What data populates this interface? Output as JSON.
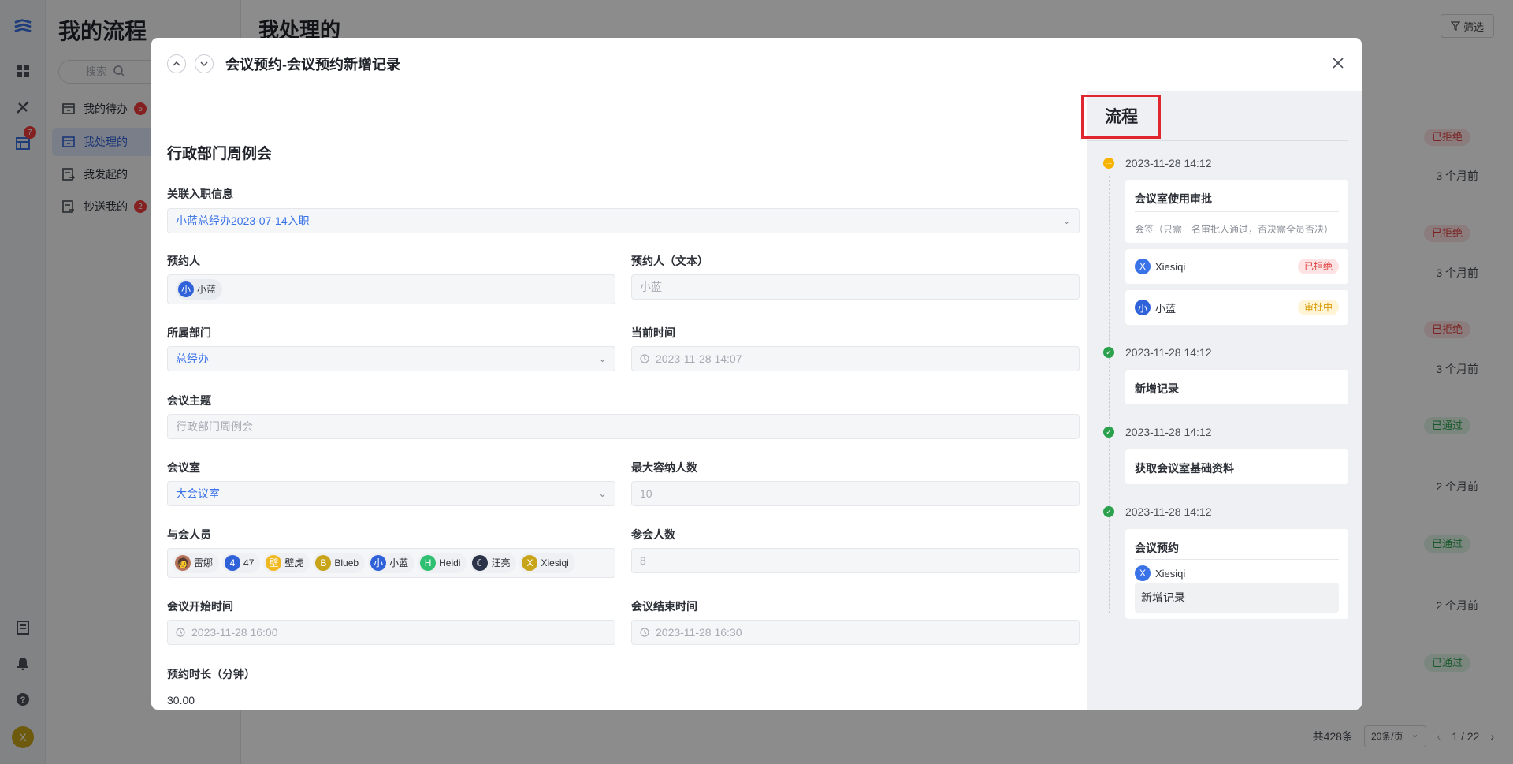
{
  "nav": {
    "title": "我的流程",
    "search_placeholder": "搜索",
    "rail_badge": "7",
    "avatar": "X",
    "items": [
      {
        "label": "我的待办",
        "count": "5"
      },
      {
        "label": "我处理的",
        "count": ""
      },
      {
        "label": "我发起的",
        "count": ""
      },
      {
        "label": "抄送我的",
        "count": "2"
      }
    ]
  },
  "main": {
    "title": "我处理的",
    "filter_label": "筛选",
    "rows": [
      {
        "status": "已拒绝",
        "type": "rejected",
        "time": "3 个月前"
      },
      {
        "status": "已拒绝",
        "type": "rejected",
        "time": "3 个月前"
      },
      {
        "status": "已拒绝",
        "type": "rejected",
        "time": "3 个月前"
      },
      {
        "status": "已通过",
        "type": "passed",
        "time": "2 个月前"
      },
      {
        "status": "已通过",
        "type": "passed",
        "time": "2 个月前"
      },
      {
        "status": "已通过",
        "type": "passed",
        "time": ""
      }
    ],
    "pager": {
      "total": "共428条",
      "size": "20条/页",
      "page": "1 / 22"
    }
  },
  "modal": {
    "title": "会议预约-会议预约新增记录",
    "form": {
      "title": "行政部门周例会",
      "onboarding_label": "关联入职信息",
      "onboarding_value": "小蓝总经办2023-07-14入职",
      "booker_label": "预约人",
      "booker_name": "小蓝",
      "booker_avatar": "小",
      "booker_text_label": "预约人（文本）",
      "booker_text_value": "小蓝",
      "dept_label": "所属部门",
      "dept_value": "总经办",
      "now_label": "当前时间",
      "now_value": "2023-11-28 14:07",
      "topic_label": "会议主题",
      "topic_value": "行政部门周例会",
      "room_label": "会议室",
      "room_value": "大会议室",
      "capacity_label": "最大容纳人数",
      "capacity_value": "10",
      "attendees_label": "与会人员",
      "attendees": [
        {
          "name": "雷娜",
          "initial": "",
          "color": "#b9745a"
        },
        {
          "name": "47",
          "initial": "4",
          "color": "#2f62d8"
        },
        {
          "name": "壁虎",
          "initial": "壁",
          "color": "#f0b820"
        },
        {
          "name": "Blueb",
          "initial": "B",
          "color": "#c8a418"
        },
        {
          "name": "小蓝",
          "initial": "小",
          "color": "#2f62d8"
        },
        {
          "name": "Heidi",
          "initial": "H",
          "color": "#2fbf71"
        },
        {
          "name": "汪亮",
          "initial": "",
          "color": "#2a3348"
        },
        {
          "name": "Xiesiqi",
          "initial": "X",
          "color": "#c8a418"
        }
      ],
      "count_label": "参会人数",
      "count_value": "8",
      "start_label": "会议开始时间",
      "start_value": "2023-11-28 16:00",
      "end_label": "会议结束时间",
      "end_value": "2023-11-28 16:30",
      "duration_label": "预约时长（分钟）",
      "duration_value": "30.00"
    },
    "flow": {
      "tab": "流程",
      "steps": [
        {
          "time": "2023-11-28 14:12",
          "title": "会议室使用审批",
          "desc": "会签（只需一名审批人通过，否决需全员否决）",
          "approvers": [
            {
              "name": "Xiesiqi",
              "initial": "X",
              "status": "已拒绝"
            },
            {
              "name": "小蓝",
              "initial": "小",
              "status": "审批中"
            }
          ]
        },
        {
          "time": "2023-11-28 14:12",
          "title": "新增记录"
        },
        {
          "time": "2023-11-28 14:12",
          "title": "获取会议室基础资料"
        },
        {
          "time": "2023-11-28 14:12",
          "title": "会议预约",
          "person": "Xiesiqi",
          "person_initial": "X",
          "record": "新增记录"
        }
      ]
    }
  }
}
